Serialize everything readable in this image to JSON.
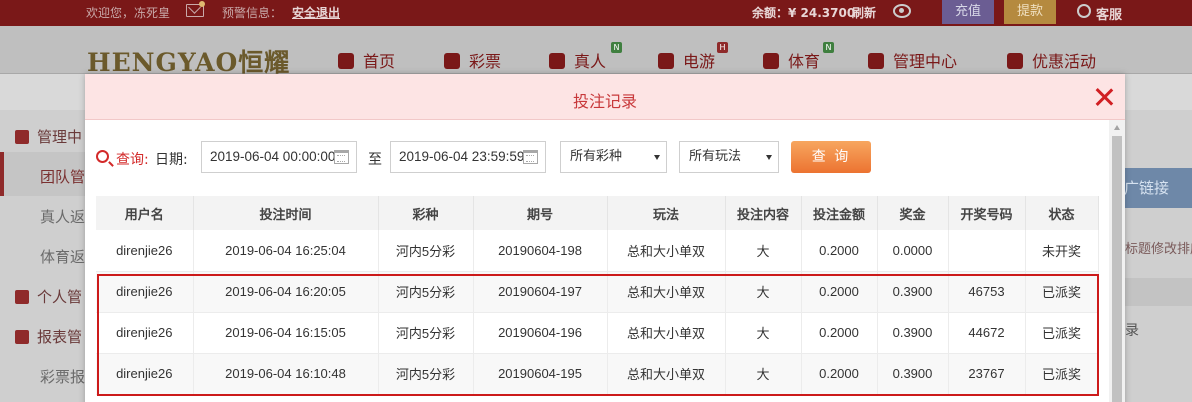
{
  "topbar": {
    "welcome": "欢迎您，冻死皇",
    "alert_label": "预警信息：",
    "logout": "安全退出",
    "balance": "余额：¥ 24.3700",
    "refresh": "刷新",
    "deposit": "充值",
    "withdraw": "提款",
    "support": "客服"
  },
  "nav": {
    "logo": "HENGYAO恒耀",
    "items": [
      {
        "label": "首页",
        "badge": ""
      },
      {
        "label": "彩票",
        "badge": ""
      },
      {
        "label": "真人",
        "badge": "N"
      },
      {
        "label": "电游",
        "badge": "H"
      },
      {
        "label": "体育",
        "badge": "N"
      },
      {
        "label": "管理中心",
        "badge": ""
      },
      {
        "label": "优惠活动",
        "badge": ""
      }
    ]
  },
  "sidebar": {
    "items": [
      "管理中",
      "团队管",
      "真人返",
      "体育返",
      "个人管",
      "报表管",
      "彩票报"
    ]
  },
  "background_right": {
    "link_button": "广链接",
    "note": "标题修改排序",
    "record": "录"
  },
  "modal": {
    "title": "投注记录",
    "query_label": "查询:",
    "date_label": "日期:",
    "start_date": "2019-06-04 00:00:00",
    "to_label": "至",
    "end_date": "2019-06-04 23:59:59",
    "lottery_select": "所有彩种",
    "play_select": "所有玩法",
    "query_button": "查 询"
  },
  "table": {
    "headers": [
      "用户名",
      "投注时间",
      "彩种",
      "期号",
      "玩法",
      "投注内容",
      "投注金额",
      "奖金",
      "开奖号码",
      "状态"
    ],
    "rows": [
      [
        "direnjie26",
        "2019-06-04 16:25:04",
        "河内5分彩",
        "20190604-198",
        "总和大小单双",
        "大",
        "0.2000",
        "0.0000",
        "",
        "未开奖"
      ],
      [
        "direnjie26",
        "2019-06-04 16:20:05",
        "河内5分彩",
        "20190604-197",
        "总和大小单双",
        "大",
        "0.2000",
        "0.3900",
        "46753",
        "已派奖"
      ],
      [
        "direnjie26",
        "2019-06-04 16:15:05",
        "河内5分彩",
        "20190604-196",
        "总和大小单双",
        "大",
        "0.2000",
        "0.3900",
        "44672",
        "已派奖"
      ],
      [
        "direnjie26",
        "2019-06-04 16:10:48",
        "河内5分彩",
        "20190604-195",
        "总和大小单双",
        "大",
        "0.2000",
        "0.3900",
        "23767",
        "已派奖"
      ]
    ]
  },
  "colors": {
    "accent_red": "#d11f23",
    "status_open": "#2f8a2f",
    "status_paid": "#d02525",
    "query_button": "#ec7331"
  }
}
